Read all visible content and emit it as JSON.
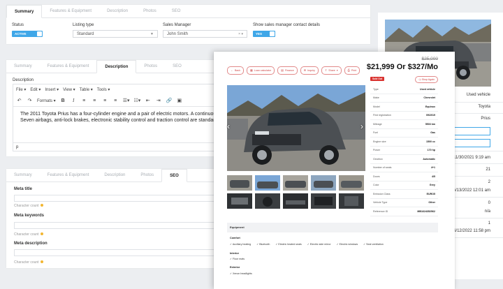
{
  "panels": {
    "top": {
      "tabs": [
        "Summary",
        "Features & Equipment",
        "Description",
        "Photos",
        "SEO"
      ],
      "active_tab": 0,
      "status_label": "Status",
      "status_value": "ACTIVE",
      "listing_type_label": "Listing type",
      "listing_type_value": "Standard",
      "sales_manager_label": "Sales Manager",
      "sales_manager_value": "John Smith",
      "show_contact_label": "Show sales manager contact details",
      "show_contact_value": "YES"
    },
    "description": {
      "tabs": [
        "Summary",
        "Features & Equipment",
        "Description",
        "Photos",
        "SEO"
      ],
      "active_tab": 2,
      "field_label": "Description",
      "menu": [
        "File",
        "Edit",
        "Insert",
        "View",
        "Table",
        "Tools"
      ],
      "formats_label": "Formats",
      "text_line1": "The 2011 Toyota Prius has a four-cylinder engine and a pair of electric motors. A continuous",
      "text_line2": "Seven airbags, anti-lock brakes, electronic stability control and traction control are standard",
      "status_path": "p"
    },
    "seo": {
      "tabs": [
        "Summary",
        "Features & Equipment",
        "Description",
        "Photos",
        "SEO"
      ],
      "active_tab": 4,
      "meta_title_label": "Meta title",
      "meta_keywords_label": "Meta keywords",
      "meta_description_label": "Meta description",
      "char_count_label": "Character count"
    }
  },
  "preview": {
    "buttons": [
      "Back",
      "Loan calculator",
      "Finance",
      "Inquiry",
      "Share",
      "Print"
    ],
    "old_price": "$25,000",
    "price": "$21,999 Or $327/Mo",
    "badge": "Sold Out",
    "shop_pill": "Shop Again",
    "specs": [
      {
        "k": "Type",
        "v": "Used vehicle"
      },
      {
        "k": "Make",
        "v": "Chevrolet"
      },
      {
        "k": "Model",
        "v": "Equinox"
      },
      {
        "k": "First registration",
        "v": "09/2019"
      },
      {
        "k": "Mileage",
        "v": "5503 km"
      },
      {
        "k": "Fuel",
        "v": "Gas"
      },
      {
        "k": "Engine size",
        "v": "1500 cc"
      },
      {
        "k": "Power",
        "v": "170 hp"
      },
      {
        "k": "Gearbox",
        "v": "Automatic"
      },
      {
        "k": "Number of seats",
        "v": "4+1"
      },
      {
        "k": "Doors",
        "v": "4/5"
      },
      {
        "k": "Color",
        "v": "Grey"
      },
      {
        "k": "Emission Class",
        "v": "EURO5"
      },
      {
        "k": "Vehicle Type",
        "v": "Other"
      },
      {
        "k": "Reference ID",
        "v": "MB1624352562"
      }
    ],
    "equipment_title": "Equipment",
    "comfort_label": "Comfort",
    "comfort_items": [
      "Auxiliary heating",
      "Bluetooth",
      "Electric heated seats",
      "Electric side mirror",
      "Electric windows",
      "Seat ventilation"
    ],
    "interior_label": "Interior",
    "interior_items": [
      "Floor mats"
    ],
    "exterior_label": "Exterior",
    "exterior_items": [
      "Xenon headlights"
    ]
  },
  "side": {
    "type_value": "Used vehicle",
    "make_value": "Toyota",
    "model_value": "Prius",
    "date1": "11/30/2021 9:19 am",
    "n1": "21",
    "n2": "2",
    "date2": "6/13/2022 12:01 am",
    "n3": "0",
    "na": "n/a",
    "n4": "1",
    "date3": "6/12/2022 11:58 pm"
  },
  "colors": {
    "accent": "#3fa7e8",
    "preview_red": "#d9322f",
    "background": "#eceef1"
  }
}
